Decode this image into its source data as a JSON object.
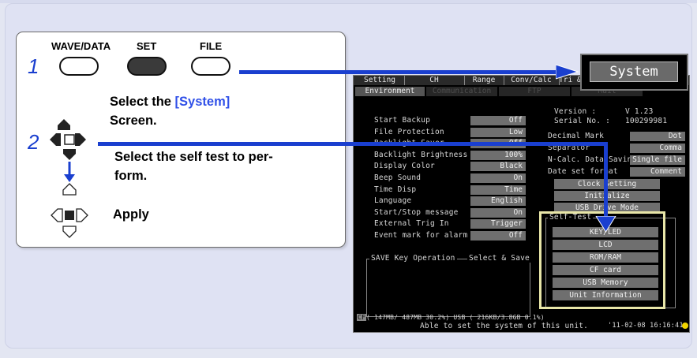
{
  "instructions": {
    "step1_number": "1",
    "step2_number": "2",
    "keys": {
      "wave_data": "WAVE/DATA",
      "set": "SET",
      "file": "FILE"
    },
    "select_system_prefix": "Select the ",
    "select_system_highlight": "[System]",
    "select_system_suffix": "Screen.",
    "select_self_test_line1": "Select the self test to per-",
    "select_self_test_line2": "form.",
    "apply": "Apply"
  },
  "screen": {
    "system_tab": "System",
    "tabs": [
      "Setting",
      "CH",
      "Range",
      "Conv/Calc",
      "Tri & ..."
    ],
    "subtabs": [
      "Environment",
      "Communication",
      "FTP",
      "Mail"
    ],
    "version_label": "Version    :",
    "version_value": "V 1.23",
    "serial_label": "Serial No. :",
    "serial_value": "100299981",
    "settings": [
      {
        "label": "Start Backup",
        "value": "Off"
      },
      {
        "label": "File Protection",
        "value": "Low"
      },
      {
        "label": "Backlight Saver",
        "value": "Off"
      },
      {
        "label": "Backlight Brightness",
        "value": "100%"
      },
      {
        "label": "Display Color",
        "value": "Black"
      },
      {
        "label": "Beep Sound",
        "value": "On"
      },
      {
        "label": "Time Disp",
        "value": "Time"
      },
      {
        "label": "Language",
        "value": "English"
      },
      {
        "label": "Start/Stop message",
        "value": "On"
      },
      {
        "label": "External Trig In",
        "value": "Trigger"
      },
      {
        "label": "Event mark for alarm",
        "value": "Off"
      }
    ],
    "decimal_mark_label": "Decimal Mark",
    "decimal_mark_value": "Dot",
    "separator_label": "Separator",
    "separator_value": "Comma",
    "ncalc_label": "N-Calc. Data Saving",
    "ncalc_value": "Single file",
    "dateset_label": "Date set format",
    "dateset_value": "Comment",
    "clock_setting": "Clock Setting",
    "initialize": "Initialize",
    "usb_drive_mode": "USB Drive Mode",
    "save_key_label": "SAVE Key Operation",
    "save_key_value": "Select & Save",
    "self_test_title": "Self-Test",
    "self_test_items": [
      "KEY/LED",
      "LCD",
      "ROM/RAM",
      "CF card",
      "USB Memory",
      "Unit Information"
    ],
    "footer_storage": "( 147MB/ 487MB 30.2%)  USB ( 216KB/3.8GB  0.1%)",
    "footer_message": "Able to set the system of this unit.",
    "footer_time": "'11-02-08 16:16:41"
  },
  "colors": {
    "arrow_blue": "#1a3fcf",
    "highlight_blue": "#3050e8",
    "selftest_frame": "#e8e6a8"
  }
}
